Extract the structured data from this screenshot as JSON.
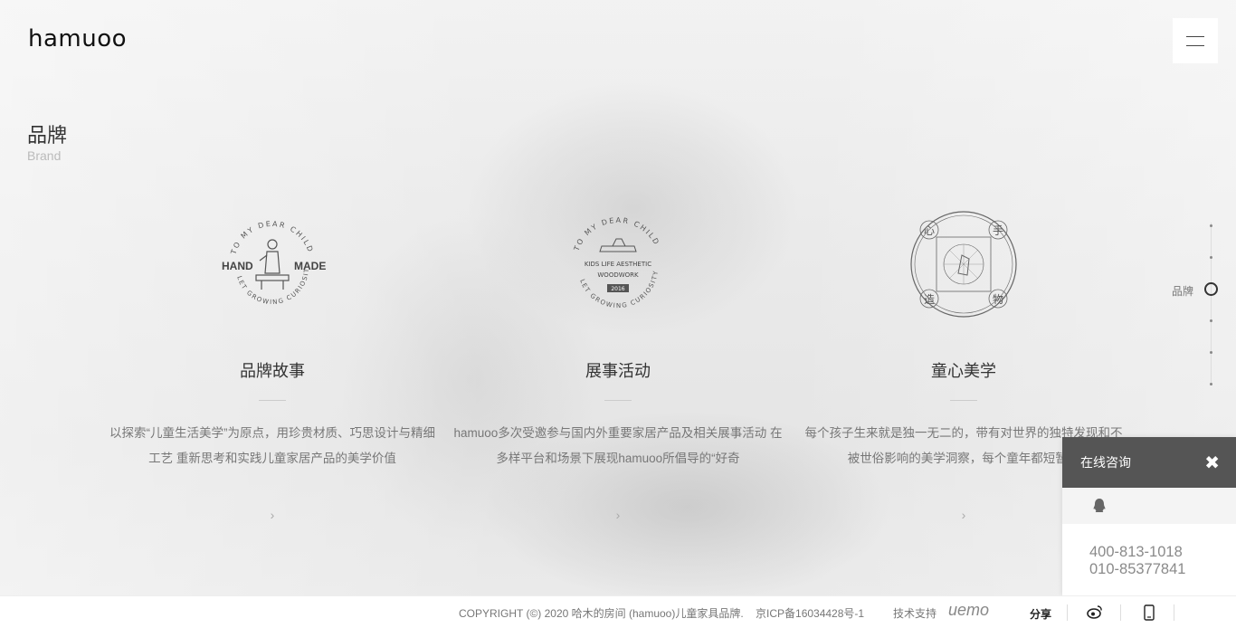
{
  "header": {
    "logo_text": "hamuoo",
    "menu_icon": "hamburger-icon"
  },
  "section": {
    "title": "品牌",
    "subtitle": "Brand"
  },
  "columns": [
    {
      "title": "品牌故事",
      "desc": "以探索“儿童生活美学”为原点，用珍贵材质、巧思设计与精细工艺 重新思考和实践儿童家居产品的美学价值",
      "badge_top": "TO MY DEAR CHILD",
      "badge_left": "HAND",
      "badge_right": "MADE",
      "badge_bottom": "LET GROWING CURIOSITY"
    },
    {
      "title": "展事活动",
      "desc": "hamuoo多次受邀参与国内外重要家居产品及相关展事活动 在多样平台和场景下展现hamuoo所倡导的“好奇",
      "badge_top": "TO MY DEAR CHILD",
      "badge_line1": "KIDS LIFE AESTHETIC",
      "badge_line2": "WOODWORK",
      "badge_year": "2016",
      "badge_bottom": "LET GROWING CURIOSITY"
    },
    {
      "title": "童心美学",
      "desc": "每个孩子生来就是独一无二的，带有对世界的独特发现和不被世俗影响的美学洞察，每个童年都短暂而",
      "badge_chars": [
        "心",
        "手",
        "造",
        "物"
      ]
    }
  ],
  "sidenav": {
    "active_label": "品牌"
  },
  "consult": {
    "title": "在线咨询",
    "close": "✖",
    "qq_icon": "qq-penguin-icon",
    "phone1": "400-813-1018",
    "phone2": "010-85377841"
  },
  "footer": {
    "copyright": "COPYRIGHT (©) 2020 哈木的房间 (hamuoo)儿童家具品牌.    京ICP备16034428号-1",
    "tech_support": "技术支持",
    "tech_brand": "uemo",
    "share": "分享",
    "weibo_icon": "weibo-icon",
    "mobile_icon": "mobile-icon"
  }
}
